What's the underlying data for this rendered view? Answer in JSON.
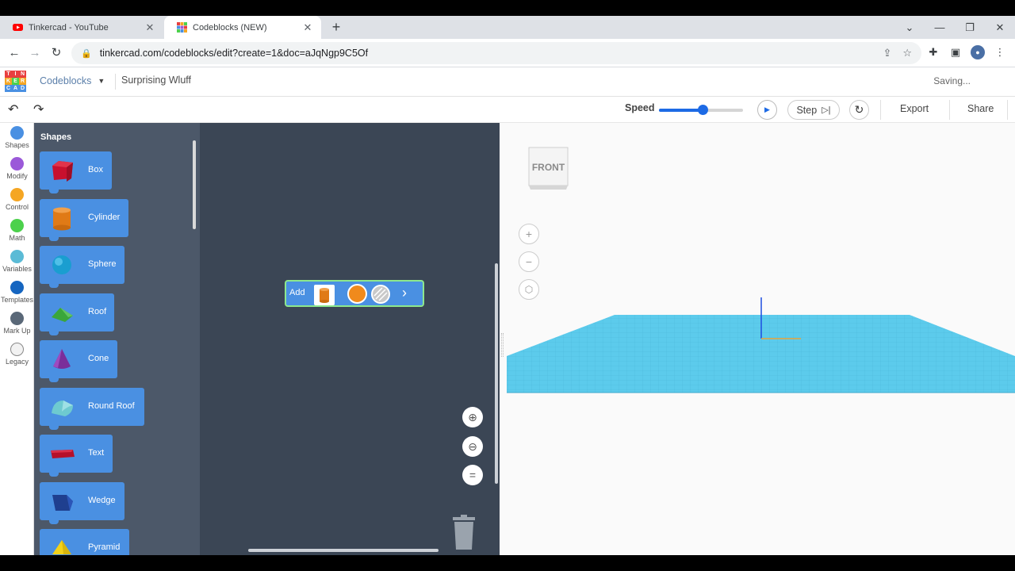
{
  "browser": {
    "tabs": [
      {
        "title": "Tinkercad - YouTube",
        "active": false
      },
      {
        "title": "Codeblocks (NEW)",
        "active": true
      }
    ],
    "url": "tinkercad.com/codeblocks/edit?create=1&doc=aJqNgp9C5Of"
  },
  "app": {
    "logo_letters": [
      "T",
      "I",
      "N",
      "K",
      "E",
      "R",
      "C",
      "A",
      "D"
    ],
    "section": "Codeblocks",
    "doc_name": "Surprising Wluff",
    "status": "Saving..."
  },
  "actionbar": {
    "speed_label": "Speed",
    "speed_value": 0.52,
    "step_label": "Step",
    "export_label": "Export",
    "share_label": "Share"
  },
  "categories": [
    {
      "label": "Shapes",
      "color": "#4a90e2"
    },
    {
      "label": "Modify",
      "color": "#9b59d9"
    },
    {
      "label": "Control",
      "color": "#f5a623"
    },
    {
      "label": "Math",
      "color": "#4cd14c"
    },
    {
      "label": "Variables",
      "color": "#5bbbd6"
    },
    {
      "label": "Templates",
      "color": "#1565c0"
    },
    {
      "label": "Mark Up",
      "color": "#5a6878"
    },
    {
      "label": "Legacy",
      "color": "#f2f2f2"
    }
  ],
  "flyout": {
    "heading": "Shapes",
    "blocks": [
      {
        "label": "Box",
        "shape": "box"
      },
      {
        "label": "Cylinder",
        "shape": "cylinder"
      },
      {
        "label": "Sphere",
        "shape": "sphere"
      },
      {
        "label": "Roof",
        "shape": "roof"
      },
      {
        "label": "Cone",
        "shape": "cone"
      },
      {
        "label": "Round Roof",
        "shape": "round-roof"
      },
      {
        "label": "Text",
        "shape": "text"
      },
      {
        "label": "Wedge",
        "shape": "wedge"
      },
      {
        "label": "Pyramid",
        "shape": "pyramid"
      }
    ]
  },
  "workspace": {
    "add_block_label": "Add",
    "add_color": "#f08a1c"
  },
  "viewport": {
    "viewcube_label": "FRONT"
  }
}
